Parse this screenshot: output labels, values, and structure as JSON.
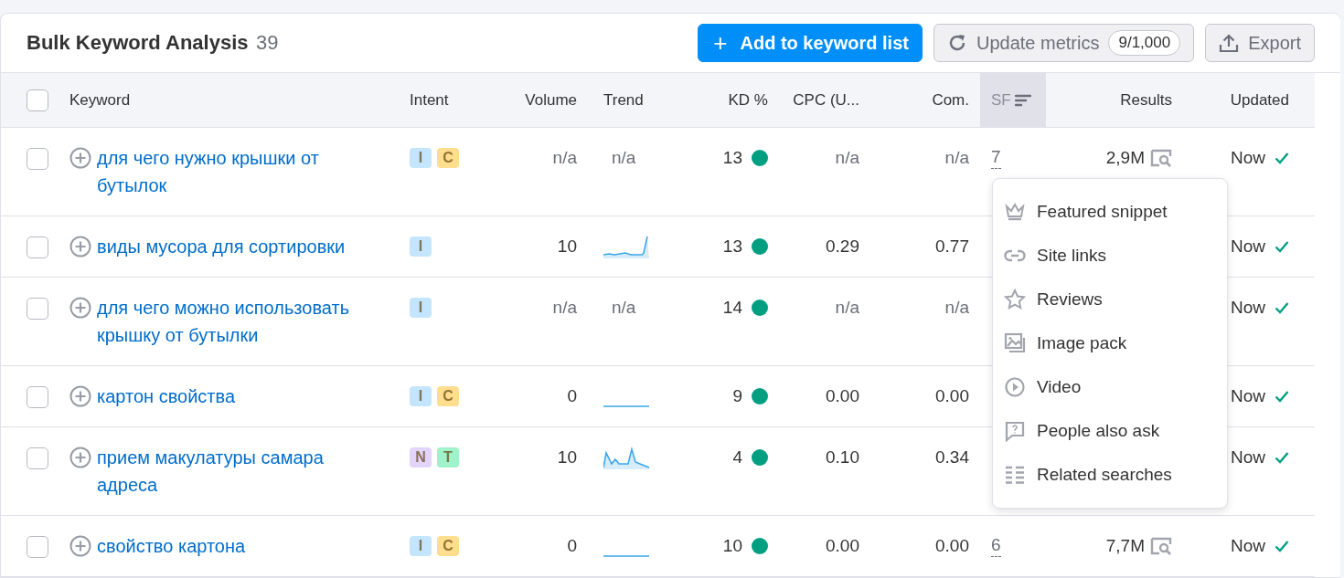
{
  "header": {
    "title": "Bulk Keyword Analysis",
    "count": "39",
    "add_button": {
      "icon": "+",
      "label": "Add to keyword list"
    },
    "update_button": {
      "label": "Update metrics",
      "badge": "9/1,000"
    },
    "export_button": {
      "label": "Export"
    }
  },
  "table": {
    "select_all": {
      "checked": false
    },
    "columns": [
      {
        "label": "Keyword",
        "sorted": false
      },
      {
        "label": "Intent",
        "sorted": false
      },
      {
        "label": "Volume",
        "sorted": false
      },
      {
        "label": "Trend",
        "sorted": false
      },
      {
        "label": "KD %",
        "sorted": false
      },
      {
        "label": "CPC (U...",
        "sorted": false
      },
      {
        "label": "Com.",
        "sorted": false
      },
      {
        "label": "SF",
        "sorted": true
      },
      {
        "label": "Results",
        "sorted": false
      },
      {
        "label": "Updated",
        "sorted": false
      }
    ],
    "rows": [
      {
        "checked": false,
        "keyword": "для чего нужно крышки от бутылок",
        "intent": [
          {
            "label": "I",
            "color": "#c4e5fe"
          },
          {
            "label": "C",
            "color": "#ffdf8f"
          }
        ],
        "volume": "n/a",
        "trend": {
          "kind": "text",
          "text": "n/a"
        },
        "kd": {
          "value": "13",
          "color": "#009f81"
        },
        "cpc": "n/a",
        "com": "n/a",
        "sf": "7",
        "results": "2,9M",
        "updated": "Now"
      },
      {
        "checked": false,
        "keyword": "виды мусора для сортировки",
        "intent": [
          {
            "label": "I",
            "color": "#c4e5fe"
          }
        ],
        "volume": "10",
        "trend": {
          "kind": "spike"
        },
        "kd": {
          "value": "13",
          "color": "#009f81"
        },
        "cpc": "0.29",
        "com": "0.77",
        "updated": "Now"
      },
      {
        "checked": false,
        "keyword": "для чего можно использовать крышку от бутылки",
        "intent": [
          {
            "label": "I",
            "color": "#c4e5fe"
          }
        ],
        "volume": "n/a",
        "trend": {
          "kind": "text",
          "text": "n/a"
        },
        "kd": {
          "value": "14",
          "color": "#009f81"
        },
        "cpc": "n/a",
        "com": "n/a",
        "updated": "Now"
      },
      {
        "checked": false,
        "keyword": "картон свойства",
        "intent": [
          {
            "label": "I",
            "color": "#c4e5fe"
          },
          {
            "label": "C",
            "color": "#ffdf8f"
          }
        ],
        "volume": "0",
        "trend": {
          "kind": "flat"
        },
        "kd": {
          "value": "9",
          "color": "#009f81"
        },
        "cpc": "0.00",
        "com": "0.00",
        "updated": "Now"
      },
      {
        "checked": false,
        "keyword": "прием макулатуры самара адреса",
        "intent": [
          {
            "label": "N",
            "color": "#e3d4fc"
          },
          {
            "label": "T",
            "color": "#9ff2c9"
          }
        ],
        "volume": "10",
        "trend": {
          "kind": "peaks"
        },
        "kd": {
          "value": "4",
          "color": "#009f81"
        },
        "cpc": "0.10",
        "com": "0.34",
        "updated": "Now"
      },
      {
        "checked": false,
        "keyword": "свойство картона",
        "intent": [
          {
            "label": "I",
            "color": "#c4e5fe"
          },
          {
            "label": "C",
            "color": "#ffdf8f"
          }
        ],
        "volume": "0",
        "trend": {
          "kind": "flat"
        },
        "kd": {
          "value": "10",
          "color": "#009f81"
        },
        "cpc": "0.00",
        "com": "0.00",
        "sf": "6",
        "results": "7,7M",
        "updated": "Now"
      }
    ]
  },
  "sf_menu": {
    "items": [
      {
        "kind": "crown",
        "label": "Featured snippet"
      },
      {
        "kind": "link",
        "label": "Site links"
      },
      {
        "kind": "star",
        "label": "Reviews"
      },
      {
        "kind": "image",
        "label": "Image pack"
      },
      {
        "kind": "play",
        "label": "Video"
      },
      {
        "kind": "question",
        "label": "People also ask"
      },
      {
        "kind": "list",
        "label": "Related searches"
      }
    ]
  }
}
